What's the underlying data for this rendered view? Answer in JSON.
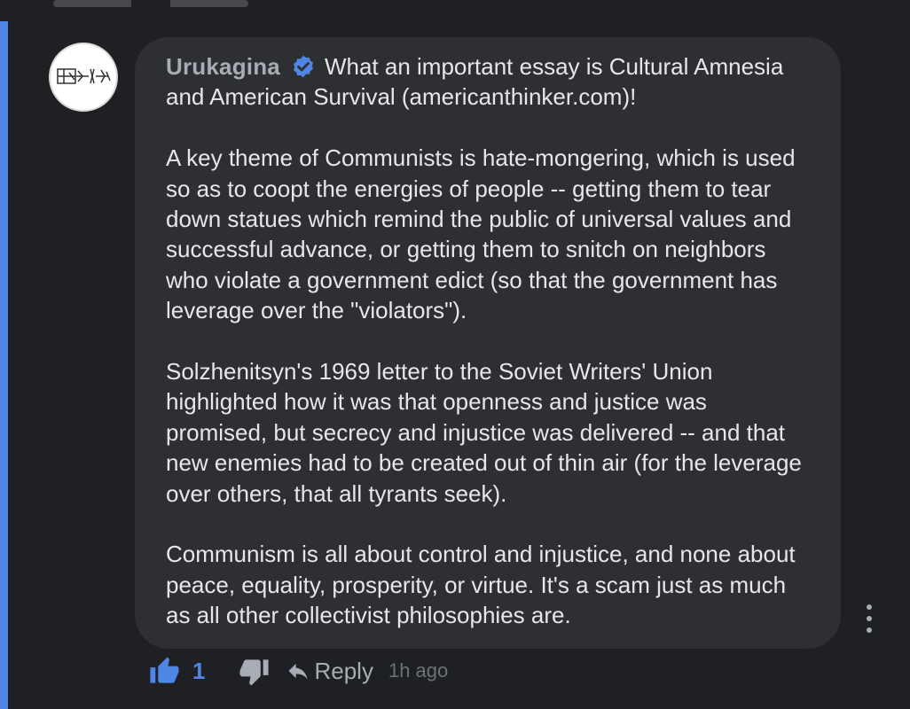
{
  "comment": {
    "author": "Urukagina",
    "verified": true,
    "first_paragraph": "What an important essay is Cultural Amnesia and American Survival (americanthinker.com)!",
    "paragraphs": [
      "A key theme of Communists is hate-mongering, which is used so as to coopt the energies of people -- getting them to tear down statues which remind the public of universal values and successful advance, or getting them to snitch on neighbors who violate a government edict (so that the government has leverage over the \"violators\").",
      "Solzhenitsyn's 1969 letter to the Soviet Writers' Union highlighted how it was that openness and justice was promised, but secrecy and injustice was delivered -- and that new enemies had to be created out of thin air (for the leverage over others, that all tyrants seek).",
      "Communism is all about control and injustice, and none about peace, equality, prosperity, or virtue. It's a scam just as much as all other collectivist philosophies are."
    ]
  },
  "actions": {
    "like_count": "1",
    "reply_label": "Reply",
    "timestamp": "1h ago"
  },
  "icons": {
    "verified": "verified-badge-icon",
    "like": "thumbs-up-icon",
    "dislike": "thumbs-down-icon",
    "reply": "reply-arrow-icon",
    "more": "more-vertical-icon"
  },
  "colors": {
    "background": "#1f2023",
    "bubble": "#2e2f32",
    "accent": "#4f86e6",
    "text": "#e6e7e9",
    "muted": "#a6adb5"
  }
}
